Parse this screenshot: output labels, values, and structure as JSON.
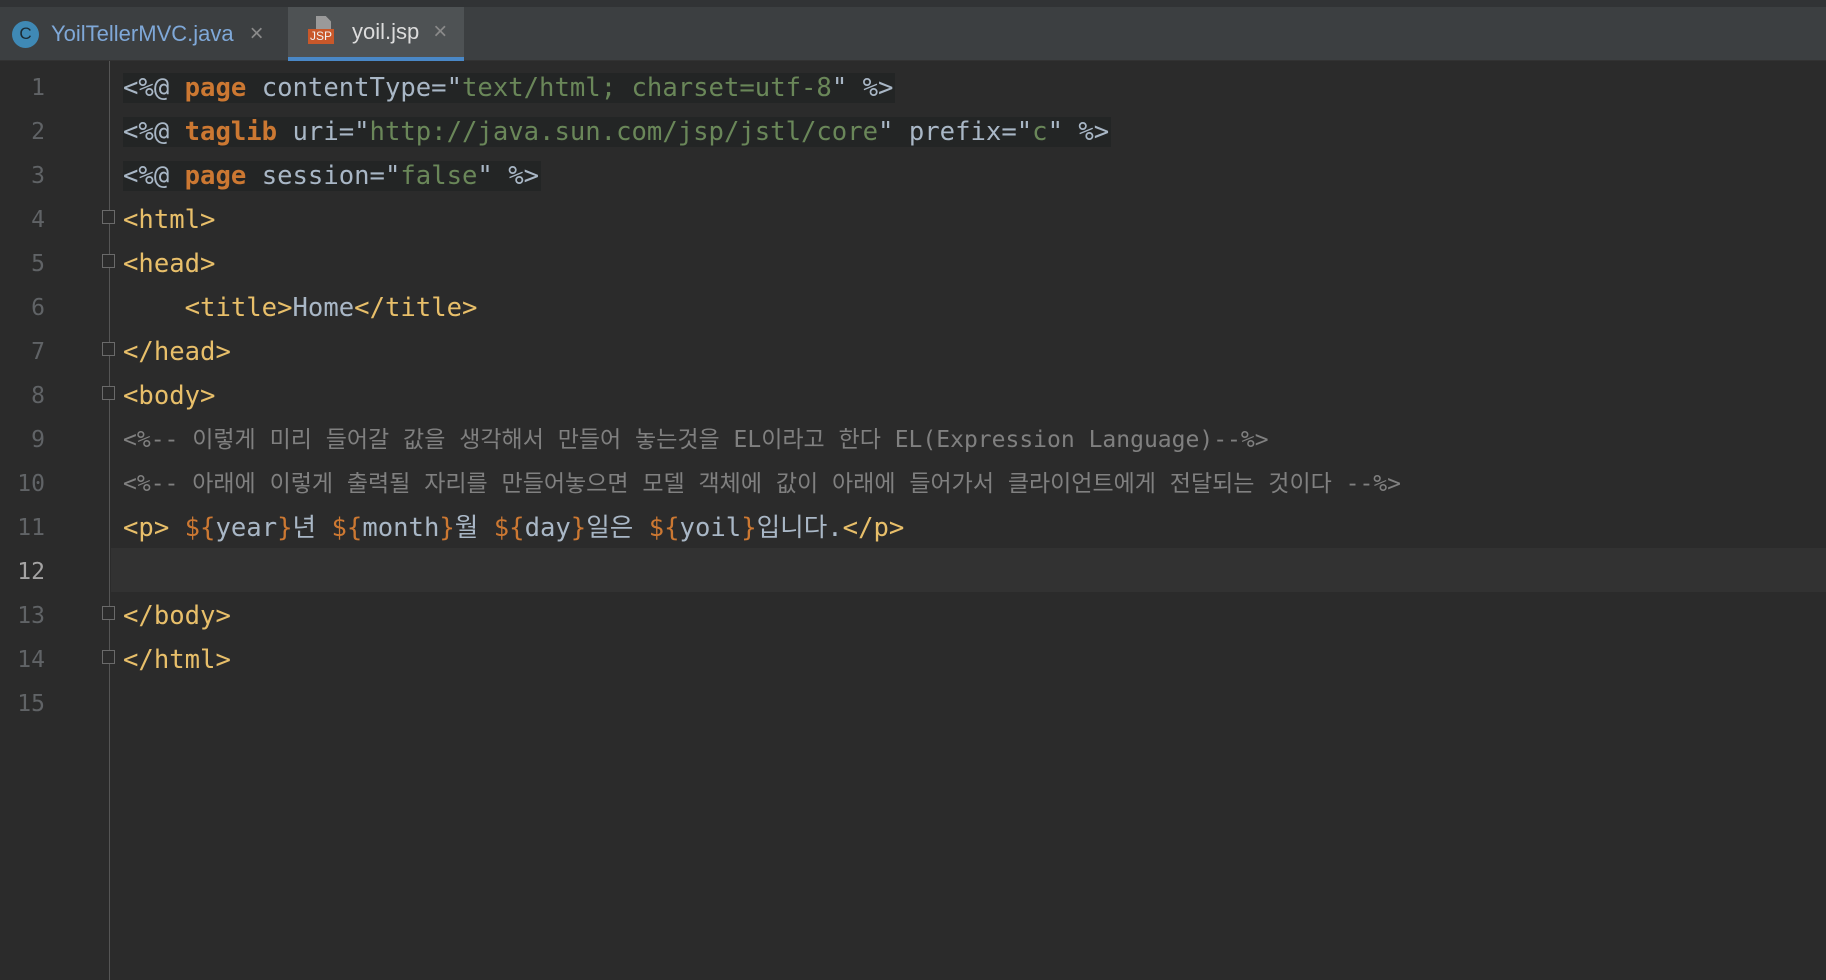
{
  "tabs": [
    {
      "label": "YoilTellerMVC.java",
      "icon": "java-class-icon",
      "active": false
    },
    {
      "label": "yoil.jsp",
      "icon": "jsp-file-icon",
      "active": true
    }
  ],
  "colors": {
    "background": "#2b2b2b",
    "keyword": "#cc7832",
    "string": "#6a8759",
    "tag": "#e8bf6a",
    "comment": "#808080",
    "text": "#a9b7c6",
    "active_tab_underline": "#4a88c7"
  },
  "editor": {
    "current_line": 12,
    "line_numbers": [
      "1",
      "2",
      "3",
      "4",
      "5",
      "6",
      "7",
      "8",
      "9",
      "10",
      "11",
      "12",
      "13",
      "14",
      "15"
    ],
    "lines": {
      "l1": {
        "open": "<%@ ",
        "kw": "page",
        "attr": " contentType=\"",
        "val": "text/html; charset=utf-8",
        "close": "\" %>"
      },
      "l2": {
        "open": "<%@ ",
        "kw": "taglib",
        "attr1": " uri=\"",
        "val1": "http://java.sun.com/jsp/jstl/core",
        "attr2": "\" prefix=\"",
        "val2": "c",
        "close": "\" %>"
      },
      "l3": {
        "open": "<%@ ",
        "kw": "page",
        "attr": " session=\"",
        "val": "false",
        "close": "\" %>"
      },
      "l4": "<html>",
      "l5": "<head>",
      "l6": {
        "indent": "    ",
        "open": "<title>",
        "text": "Home",
        "close": "</title>"
      },
      "l7": "</head>",
      "l8": "<body>",
      "l9": "<%-- 이렇게 미리 들어갈 값을 생각해서 만들어 놓는것을 EL이라고 한다 EL(Expression Language)--%>",
      "l10": "<%-- 아래에 이렇게 출력될 자리를 만들어놓으면 모델 객체에 값이 아래에 들어가서 클라이언트에게 전달되는 것이다 --%>",
      "l11": {
        "p_open": "<p>",
        "el1_open": " ${",
        "el1_var": "year",
        "el1_close": "}",
        "t1": "년",
        "el2_open": " ${",
        "el2_var": "month",
        "el2_close": "}",
        "t2": "월",
        "el3_open": " ${",
        "el3_var": "day",
        "el3_close": "}",
        "t3": "일은",
        "el4_open": " ${",
        "el4_var": "yoil",
        "el4_close": "}",
        "t4": "입니다.",
        "p_close": "</p>"
      },
      "l13": "</body>",
      "l14": "</html>"
    }
  }
}
